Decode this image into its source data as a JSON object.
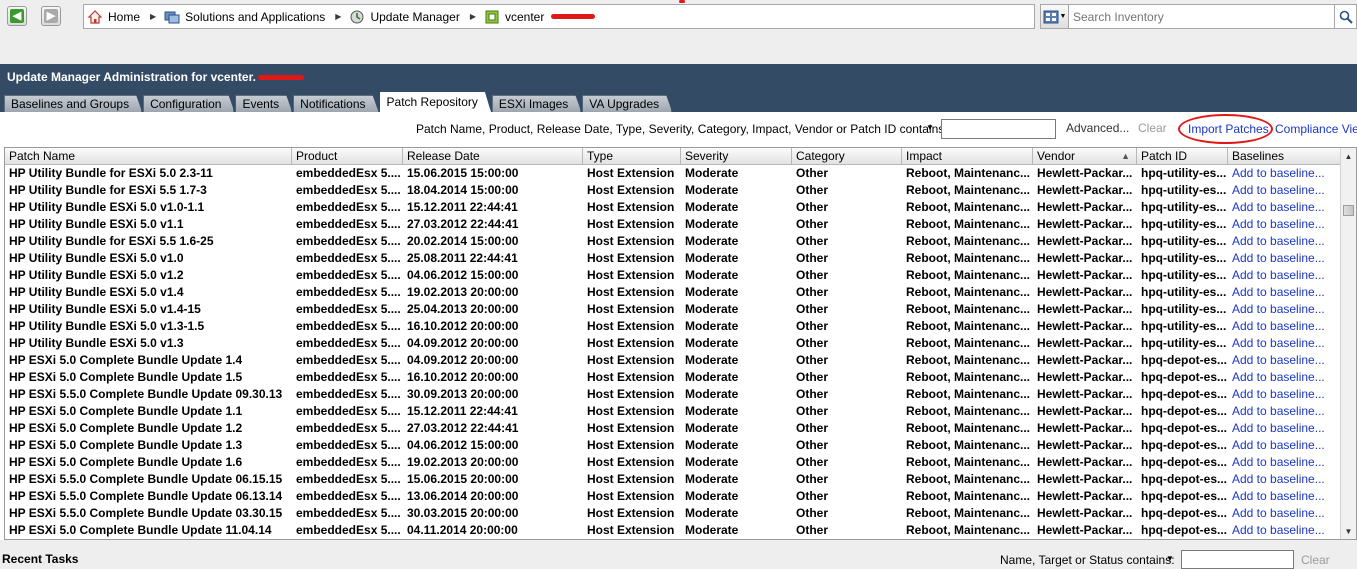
{
  "nav": {
    "back_icon": "back-arrow-icon",
    "forward_icon": "forward-arrow-icon",
    "breadcrumbs": [
      {
        "label": "Home",
        "icon": "home-icon"
      },
      {
        "label": "Solutions and Applications",
        "icon": "solutions-icon"
      },
      {
        "label": "Update Manager",
        "icon": "update-manager-icon"
      },
      {
        "label": "vcenter",
        "icon": "vcenter-icon"
      }
    ],
    "search_placeholder": "Search Inventory"
  },
  "admin": {
    "title": "Update Manager Administration for vcenter.",
    "tabs": [
      "Baselines and Groups",
      "Configuration",
      "Events",
      "Notifications",
      "Patch Repository",
      "ESXi Images",
      "VA Upgrades"
    ],
    "active_tab": "Patch Repository"
  },
  "filter": {
    "label": "Patch Name, Product, Release Date, Type, Severity, Category, Impact, Vendor or Patch ID contains:",
    "value": "",
    "advanced": "Advanced...",
    "clear": "Clear",
    "import": "Import Patches",
    "compliance": "Compliance View"
  },
  "table": {
    "columns": [
      "Patch Name",
      "Product",
      "Release Date",
      "Type",
      "Severity",
      "Category",
      "Impact",
      "Vendor",
      "Patch ID",
      "Baselines"
    ],
    "sorted_column": "Vendor",
    "rows": [
      [
        "HP Utility Bundle for ESXi 5.0 2.3-11",
        "embeddedEsx 5....",
        "15.06.2015 15:00:00",
        "Host Extension",
        "Moderate",
        "Other",
        "Reboot, Maintenanc...",
        "Hewlett-Packar...",
        "hpq-utility-es...",
        "Add to baseline..."
      ],
      [
        "HP Utility Bundle for ESXi 5.5 1.7-3",
        "embeddedEsx 5....",
        "18.04.2014 15:00:00",
        "Host Extension",
        "Moderate",
        "Other",
        "Reboot, Maintenanc...",
        "Hewlett-Packar...",
        "hpq-utility-es...",
        "Add to baseline..."
      ],
      [
        "HP Utility Bundle ESXi 5.0 v1.0-1.1",
        "embeddedEsx 5....",
        "15.12.2011 22:44:41",
        "Host Extension",
        "Moderate",
        "Other",
        "Reboot, Maintenanc...",
        "Hewlett-Packar...",
        "hpq-utility-es...",
        "Add to baseline..."
      ],
      [
        "HP Utility Bundle ESXi 5.0 v1.1",
        "embeddedEsx 5....",
        "27.03.2012 22:44:41",
        "Host Extension",
        "Moderate",
        "Other",
        "Reboot, Maintenanc...",
        "Hewlett-Packar...",
        "hpq-utility-es...",
        "Add to baseline..."
      ],
      [
        "HP Utility Bundle for ESXi 5.5 1.6-25",
        "embeddedEsx 5....",
        "20.02.2014 15:00:00",
        "Host Extension",
        "Moderate",
        "Other",
        "Reboot, Maintenanc...",
        "Hewlett-Packar...",
        "hpq-utility-es...",
        "Add to baseline..."
      ],
      [
        "HP Utility Bundle ESXi 5.0 v1.0",
        "embeddedEsx 5....",
        "25.08.2011 22:44:41",
        "Host Extension",
        "Moderate",
        "Other",
        "Reboot, Maintenanc...",
        "Hewlett-Packar...",
        "hpq-utility-es...",
        "Add to baseline..."
      ],
      [
        "HP Utility Bundle ESXi 5.0 v1.2",
        "embeddedEsx 5....",
        "04.06.2012 15:00:00",
        "Host Extension",
        "Moderate",
        "Other",
        "Reboot, Maintenanc...",
        "Hewlett-Packar...",
        "hpq-utility-es...",
        "Add to baseline..."
      ],
      [
        "HP Utility Bundle ESXi 5.0 v1.4",
        "embeddedEsx 5....",
        "19.02.2013 20:00:00",
        "Host Extension",
        "Moderate",
        "Other",
        "Reboot, Maintenanc...",
        "Hewlett-Packar...",
        "hpq-utility-es...",
        "Add to baseline..."
      ],
      [
        "HP Utility Bundle ESXi 5.0 v1.4-15",
        "embeddedEsx 5....",
        "25.04.2013 20:00:00",
        "Host Extension",
        "Moderate",
        "Other",
        "Reboot, Maintenanc...",
        "Hewlett-Packar...",
        "hpq-utility-es...",
        "Add to baseline..."
      ],
      [
        "HP Utility Bundle ESXi 5.0 v1.3-1.5",
        "embeddedEsx 5....",
        "16.10.2012 20:00:00",
        "Host Extension",
        "Moderate",
        "Other",
        "Reboot, Maintenanc...",
        "Hewlett-Packar...",
        "hpq-utility-es...",
        "Add to baseline..."
      ],
      [
        "HP Utility Bundle ESXi 5.0 v1.3",
        "embeddedEsx 5....",
        "04.09.2012 20:00:00",
        "Host Extension",
        "Moderate",
        "Other",
        "Reboot, Maintenanc...",
        "Hewlett-Packar...",
        "hpq-utility-es...",
        "Add to baseline..."
      ],
      [
        "HP ESXi 5.0 Complete Bundle Update 1.4",
        "embeddedEsx 5....",
        "04.09.2012 20:00:00",
        "Host Extension",
        "Moderate",
        "Other",
        "Reboot, Maintenanc...",
        "Hewlett-Packar...",
        "hpq-depot-es...",
        "Add to baseline..."
      ],
      [
        "HP ESXi 5.0 Complete Bundle Update 1.5",
        "embeddedEsx 5....",
        "16.10.2012 20:00:00",
        "Host Extension",
        "Moderate",
        "Other",
        "Reboot, Maintenanc...",
        "Hewlett-Packar...",
        "hpq-depot-es...",
        "Add to baseline..."
      ],
      [
        "HP ESXi 5.5.0 Complete Bundle Update 09.30.13",
        "embeddedEsx 5....",
        "30.09.2013 20:00:00",
        "Host Extension",
        "Moderate",
        "Other",
        "Reboot, Maintenanc...",
        "Hewlett-Packar...",
        "hpq-depot-es...",
        "Add to baseline..."
      ],
      [
        "HP ESXi 5.0 Complete Bundle Update 1.1",
        "embeddedEsx 5....",
        "15.12.2011 22:44:41",
        "Host Extension",
        "Moderate",
        "Other",
        "Reboot, Maintenanc...",
        "Hewlett-Packar...",
        "hpq-depot-es...",
        "Add to baseline..."
      ],
      [
        "HP ESXi 5.0 Complete Bundle Update 1.2",
        "embeddedEsx 5....",
        "27.03.2012 22:44:41",
        "Host Extension",
        "Moderate",
        "Other",
        "Reboot, Maintenanc...",
        "Hewlett-Packar...",
        "hpq-depot-es...",
        "Add to baseline..."
      ],
      [
        "HP ESXi 5.0 Complete Bundle Update 1.3",
        "embeddedEsx 5....",
        "04.06.2012 15:00:00",
        "Host Extension",
        "Moderate",
        "Other",
        "Reboot, Maintenanc...",
        "Hewlett-Packar...",
        "hpq-depot-es...",
        "Add to baseline..."
      ],
      [
        "HP ESXi 5.0 Complete Bundle Update 1.6",
        "embeddedEsx 5....",
        "19.02.2013 20:00:00",
        "Host Extension",
        "Moderate",
        "Other",
        "Reboot, Maintenanc...",
        "Hewlett-Packar...",
        "hpq-depot-es...",
        "Add to baseline..."
      ],
      [
        "HP ESXi 5.5.0 Complete Bundle Update 06.15.15",
        "embeddedEsx 5....",
        "15.06.2015 20:00:00",
        "Host Extension",
        "Moderate",
        "Other",
        "Reboot, Maintenanc...",
        "Hewlett-Packar...",
        "hpq-depot-es...",
        "Add to baseline..."
      ],
      [
        "HP ESXi 5.5.0 Complete Bundle Update 06.13.14",
        "embeddedEsx 5....",
        "13.06.2014 20:00:00",
        "Host Extension",
        "Moderate",
        "Other",
        "Reboot, Maintenanc...",
        "Hewlett-Packar...",
        "hpq-depot-es...",
        "Add to baseline..."
      ],
      [
        "HP ESXi 5.5.0 Complete Bundle Update 03.30.15",
        "embeddedEsx 5....",
        "30.03.2015 20:00:00",
        "Host Extension",
        "Moderate",
        "Other",
        "Reboot, Maintenanc...",
        "Hewlett-Packar...",
        "hpq-depot-es...",
        "Add to baseline..."
      ],
      [
        "HP ESXi 5.0 Complete Bundle Update 11.04.14",
        "embeddedEsx 5....",
        "04.11.2014 20:00:00",
        "Host Extension",
        "Moderate",
        "Other",
        "Reboot, Maintenanc...",
        "Hewlett-Packar...",
        "hpq-depot-es...",
        "Add to baseline..."
      ]
    ]
  },
  "tasks": {
    "title": "Recent Tasks",
    "filter_label": "Name, Target or Status contains:",
    "clear": "Clear"
  },
  "colors": {
    "header_bg": "#344b66",
    "link": "#1a37c6",
    "annotation": "#e01818"
  }
}
